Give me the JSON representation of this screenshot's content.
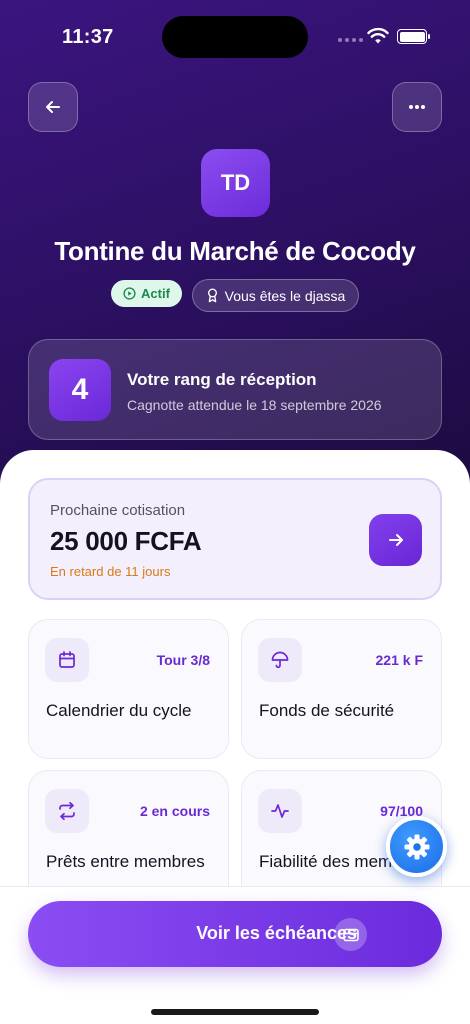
{
  "status_bar": {
    "time": "11:37"
  },
  "header": {
    "back_icon": "arrow-left-icon",
    "more_icon": "more-horizontal-icon"
  },
  "group": {
    "initials": "TD",
    "name": "Tontine du Marché de Cocody",
    "status_badge": "Actif",
    "role_badge": "Vous êtes le djassa"
  },
  "rank": {
    "number": "4",
    "title": "Votre rang de réception",
    "subtitle": "Cagnotte attendue le 18 septembre 2026"
  },
  "next_contribution": {
    "label": "Prochaine cotisation",
    "amount": "25 000 FCFA",
    "status": "En retard de 11 jours"
  },
  "tiles": [
    {
      "icon": "calendar-icon",
      "metric": "Tour 3/8",
      "title": "Calendrier du cycle"
    },
    {
      "icon": "umbrella-icon",
      "metric": "221 k F",
      "title": "Fonds de sécurité"
    },
    {
      "icon": "repeat-icon",
      "metric": "2 en cours",
      "title": "Prêts entre membres"
    },
    {
      "icon": "activity-icon",
      "metric": "97/100",
      "title": "Fiabilité des membres"
    }
  ],
  "cta": {
    "label": "Voir les échéances",
    "icon": "credit-card-icon"
  },
  "fab": {
    "icon": "gear-icon"
  },
  "colors": {
    "accent": "#6a2ad3",
    "hero_bg": "#2a0f5e",
    "warning": "#d97a16",
    "success": "#1c8a4e",
    "fab": "#1a6de6"
  }
}
